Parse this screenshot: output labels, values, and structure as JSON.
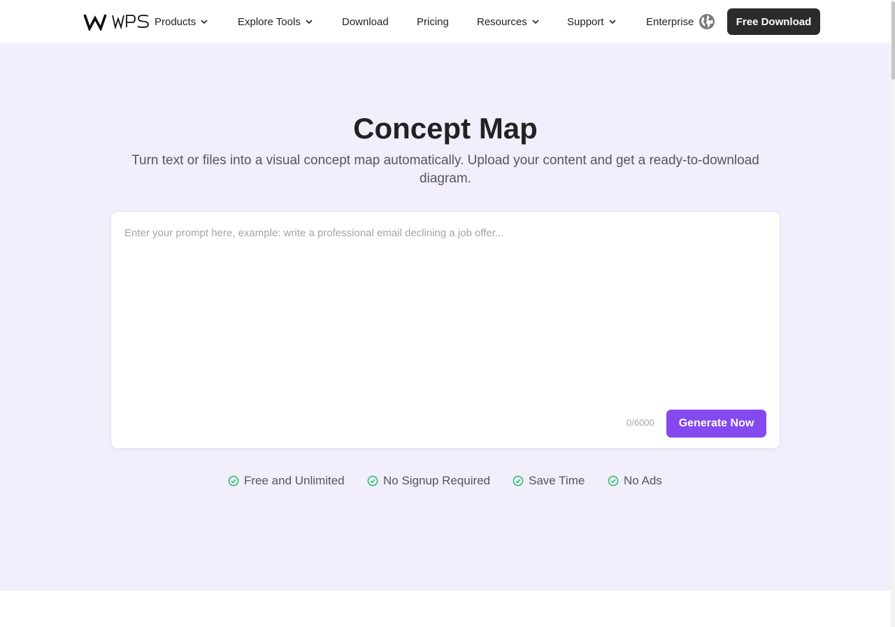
{
  "header": {
    "brand": "WPS",
    "nav": [
      {
        "label": "Products",
        "dropdown": true
      },
      {
        "label": "Explore Tools",
        "dropdown": true
      },
      {
        "label": "Download",
        "dropdown": false
      },
      {
        "label": "Pricing",
        "dropdown": false
      },
      {
        "label": "Resources",
        "dropdown": true
      },
      {
        "label": "Support",
        "dropdown": true
      },
      {
        "label": "Enterprise",
        "dropdown": false
      }
    ],
    "language_icon": "globe-icon",
    "cta_label": "Free Download"
  },
  "hero": {
    "title": "Concept Map",
    "subtitle": "Turn text or files into a visual concept map automatically. Upload your content and get a ready-to-download diagram.",
    "prompt_placeholder": "Enter your prompt here, example: write a professional email declining a job offer...",
    "prompt_value": "",
    "char_counter": "0/6000",
    "generate_label": "Generate Now",
    "features": [
      {
        "label": "Free and Unlimited",
        "icon": "check-circle-icon"
      },
      {
        "label": "No Signup Required",
        "icon": "check-circle-icon"
      },
      {
        "label": "Save Time",
        "icon": "check-circle-icon"
      },
      {
        "label": "No Ads",
        "icon": "check-circle-icon"
      }
    ]
  },
  "colors": {
    "accent": "#8549f0",
    "hero_background": "#f2eefc",
    "cta_background": "#2b2b2b",
    "check_color": "#1fbf6a"
  }
}
